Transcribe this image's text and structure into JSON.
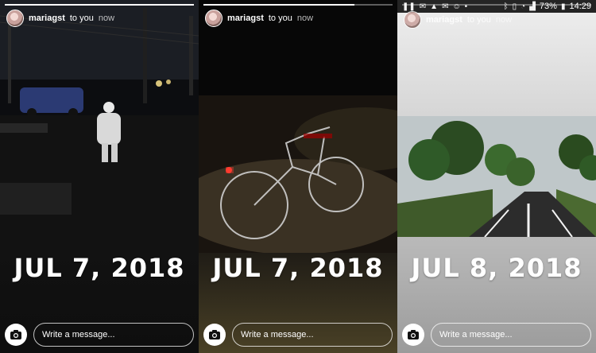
{
  "panels": [
    {
      "user": {
        "name": "mariagst",
        "recipient_text": "to you",
        "time": "now"
      },
      "date_label": "JUL 7, 2018",
      "progress": 1.0,
      "composer": {
        "placeholder": "Write a message..."
      }
    },
    {
      "user": {
        "name": "mariagst",
        "recipient_text": "to you",
        "time": "now"
      },
      "date_label": "JUL 7, 2018",
      "progress": 0.8,
      "composer": {
        "placeholder": "Write a message..."
      }
    },
    {
      "user": {
        "name": "mariagst",
        "recipient_text": "to you",
        "time": "now"
      },
      "date_label": "JUL 8, 2018",
      "progress": 0.0,
      "composer": {
        "placeholder": "Write a message..."
      },
      "status_bar": {
        "battery": "73%",
        "time": "14:29",
        "icons": [
          "pause-icon",
          "chat-icon",
          "warning-icon",
          "mail-icon",
          "emoji-icon",
          "dot-icon",
          "bluetooth-icon",
          "vibrate-icon",
          "wifi-icon",
          "signal-icon",
          "battery-icon"
        ]
      }
    }
  ],
  "icons": {
    "camera": "camera-icon"
  },
  "colors": {
    "primary_text": "#ffffff"
  }
}
